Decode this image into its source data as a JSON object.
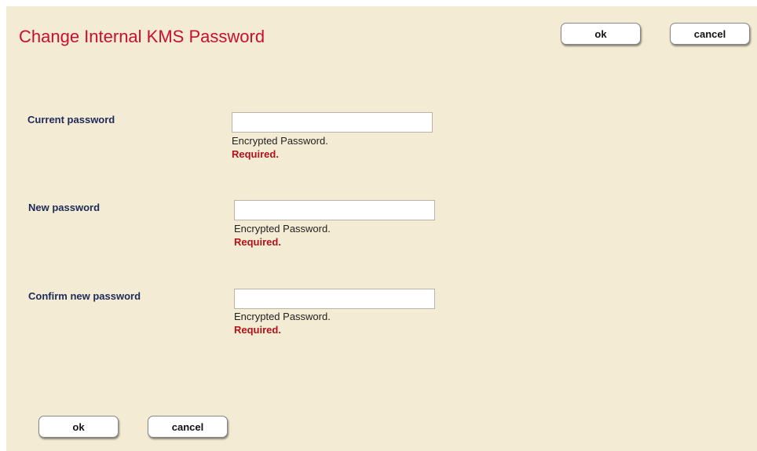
{
  "header": {
    "title": "Change Internal KMS Password",
    "ok_label": "ok",
    "cancel_label": "cancel"
  },
  "fields": [
    {
      "label": "Current password",
      "value": "",
      "hint": "Encrypted Password.",
      "required": "Required."
    },
    {
      "label": "New password",
      "value": "",
      "hint": "Encrypted Password.",
      "required": "Required."
    },
    {
      "label": "Confirm new password",
      "value": "",
      "hint": "Encrypted Password.",
      "required": "Required."
    }
  ],
  "footer": {
    "ok_label": "ok",
    "cancel_label": "cancel"
  },
  "colors": {
    "background": "#f3ebd3",
    "title": "#c8102e",
    "label": "#1e2a5a",
    "required": "#b0121c"
  }
}
